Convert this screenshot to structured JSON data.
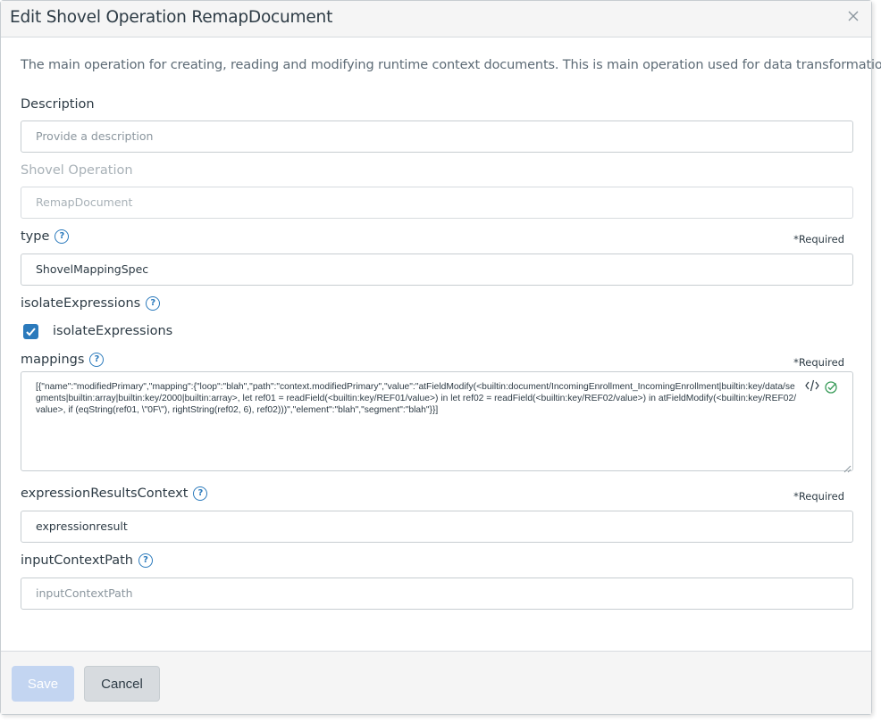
{
  "dialog": {
    "title": "Edit Shovel Operation RemapDocument",
    "description": "The main operation for creating, reading and modifying runtime context documents. This is main operation used for data transformations."
  },
  "fields": {
    "description": {
      "label": "Description",
      "placeholder": "Provide a description"
    },
    "shovel_operation": {
      "label": "Shovel Operation",
      "value": "RemapDocument"
    },
    "type": {
      "label": "type",
      "required": "*Required",
      "value": "ShovelMappingSpec"
    },
    "isolate_expressions": {
      "label": "isolateExpressions",
      "checkbox_label": "isolateExpressions",
      "checked": true
    },
    "mappings": {
      "label": "mappings",
      "required": "*Required",
      "value": "[{\"name\":\"modifiedPrimary\",\"mapping\":{\"loop\":\"blah\",\"path\":\"context.modifiedPrimary\",\"value\":\"atFieldModify(<builtin:document/IncomingEnrollment_IncomingEnrollment|builtin:key/data/segments|builtin:array|builtin:key/2000|builtin:array>, let ref01 = readField(<builtin:key/REF01/value>) in let ref02 = readField(<builtin:key/REF02/value>) in atFieldModify(<builtin:key/REF02/value>, if (eqString(ref01, \\\"0F\\\"), rightString(ref02, 6), ref02)))\",\"element\":\"blah\",\"segment\":\"blah\"}}]"
    },
    "expression_results_context": {
      "label": "expressionResultsContext",
      "required": "*Required",
      "value": "expressionresult"
    },
    "input_context_path": {
      "label": "inputContextPath",
      "placeholder": "inputContextPath"
    }
  },
  "icons": {
    "help": "?"
  },
  "footer": {
    "save_label": "Save",
    "cancel_label": "Cancel"
  },
  "colors": {
    "accent": "#2b7abc",
    "save_disabled": "#c3d5f1",
    "success": "#3a9c5a"
  }
}
